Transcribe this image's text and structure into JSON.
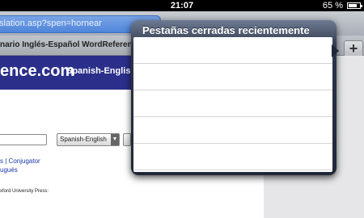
{
  "status": {
    "time": "21:07",
    "battery": "65 %"
  },
  "browser": {
    "url": "slation.asp?spen=hornear",
    "tab_title": "nario Inglés-Español WordReferen",
    "add_tab_glyph": "+"
  },
  "page": {
    "logo": "ence.com",
    "dictionary": "Spanish-English",
    "lang_select": "Spanish-English",
    "links": {
      "line1_a": "s |",
      "line1_b": "Conjugator",
      "line2": "ugués"
    },
    "oxford": "xford University Press:"
  },
  "popover": {
    "title": "Pestañas cerradas recientemente",
    "rows": [
      "",
      "",
      "",
      "",
      ""
    ]
  },
  "colors": {
    "accent_blue": "#4f85d9",
    "wr_header": "#2b2f8a",
    "popover_bg": "#1f2737"
  }
}
